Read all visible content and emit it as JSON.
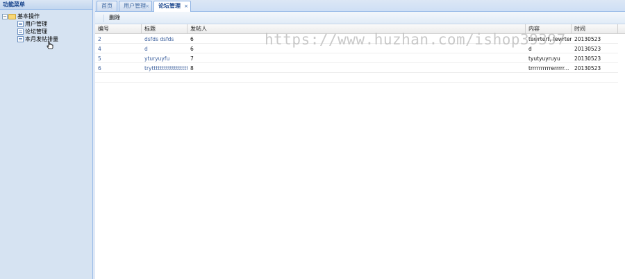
{
  "sidebar": {
    "title": "功能菜单",
    "tree": {
      "root_label": "基本操作",
      "toggle": "−",
      "children": [
        {
          "label": "用户管理"
        },
        {
          "label": "论坛管理"
        },
        {
          "label": "本月发帖排量"
        }
      ]
    }
  },
  "tabs": [
    {
      "label": "首页",
      "closable": false
    },
    {
      "label": "用户管理",
      "closable": true
    },
    {
      "label": "论坛管理",
      "closable": true,
      "active": true
    }
  ],
  "tab_close_glyph": "×",
  "toolbar": {
    "delete_label": "删除"
  },
  "grid": {
    "columns": [
      "编号",
      "标题",
      "发帖人",
      "内容",
      "时间"
    ],
    "rows": [
      {
        "id": "2",
        "title": "dsfds dsfds",
        "poster": "6",
        "content": "tewrtert, tewrtert",
        "time": "20130523"
      },
      {
        "id": "4",
        "title": "d",
        "poster": "6",
        "content": "d",
        "time": "20130523"
      },
      {
        "id": "5",
        "title": "yturyuyfu",
        "poster": "7",
        "content": "tyutyuyruyu",
        "time": "20130523"
      },
      {
        "id": "6",
        "title": "tryttttttttttttttttttt",
        "poster": "8",
        "content": "trrrrrrrrrrerrrrr...",
        "time": "20130523"
      }
    ]
  },
  "watermark": "https://www.huzhan.com/ishop39397",
  "colors": {
    "accent": "#15428b",
    "border": "#99bbe8",
    "link": "#3a5e9c"
  }
}
